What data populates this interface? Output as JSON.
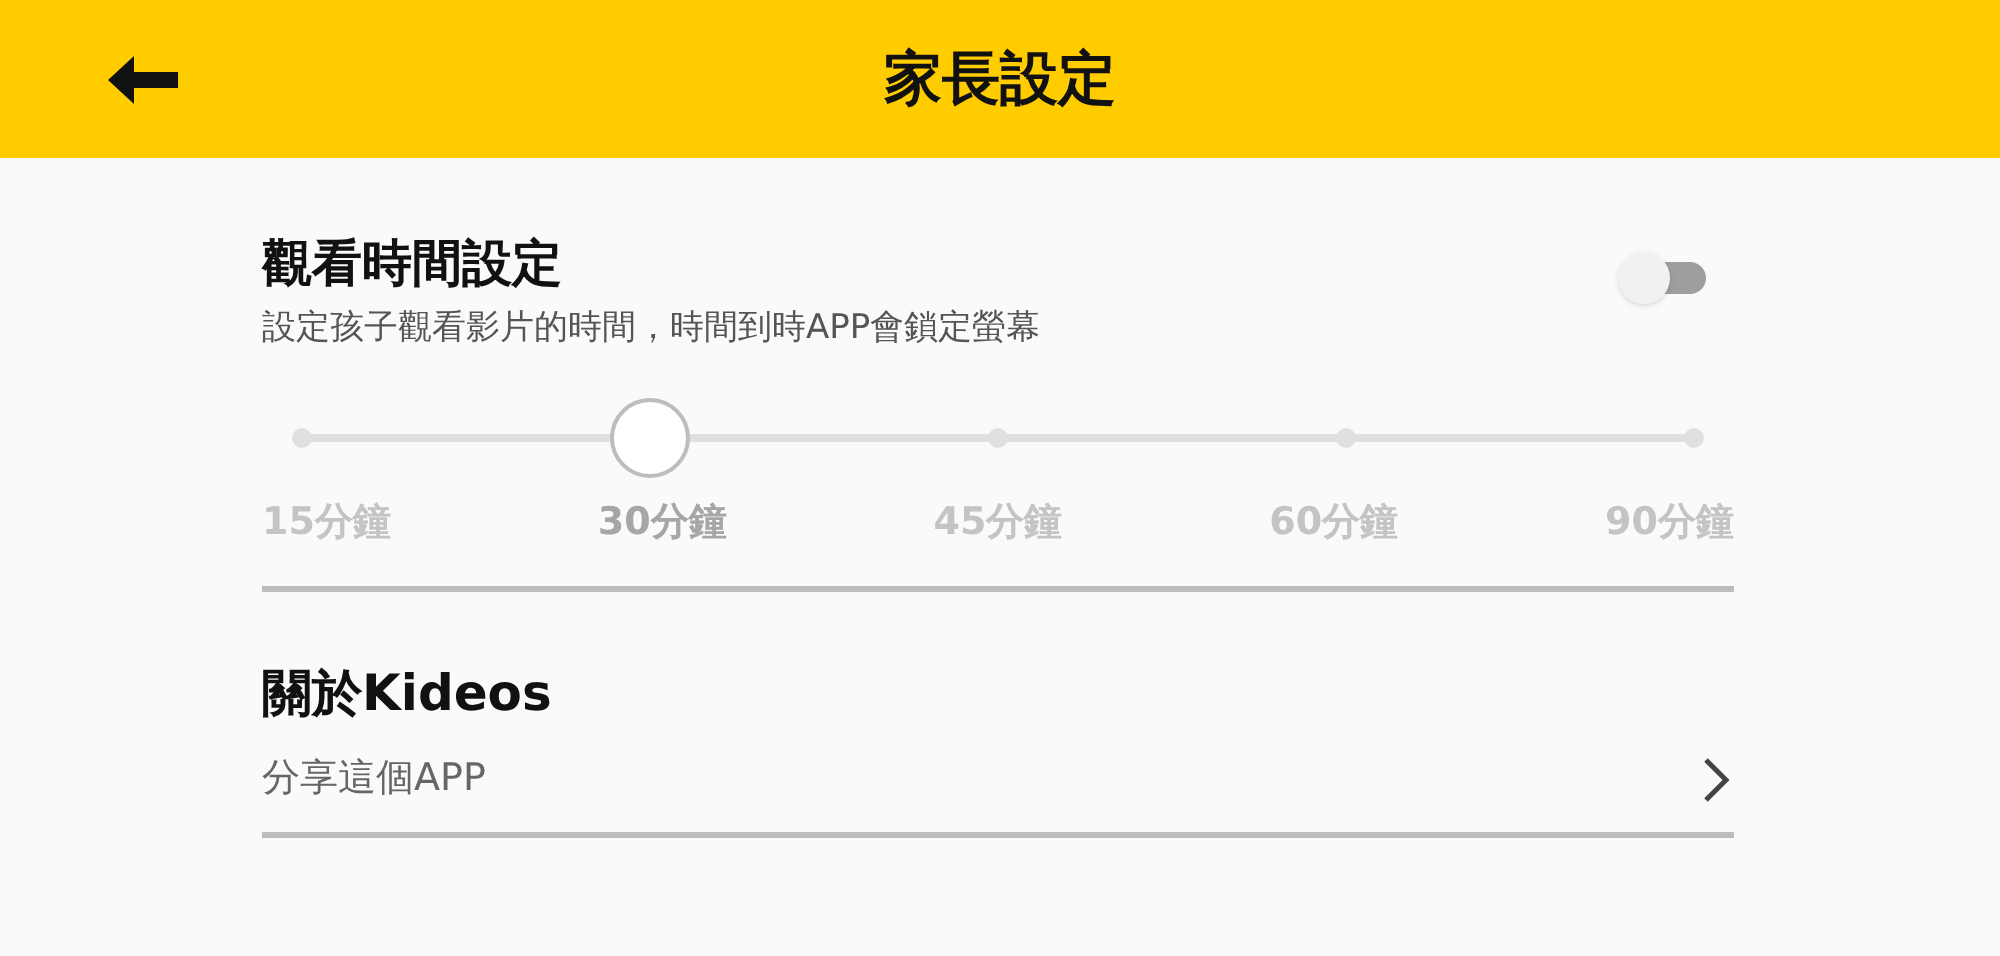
{
  "header": {
    "title": "家長設定"
  },
  "watch_time": {
    "title": "觀看時間設定",
    "description": "設定孩子觀看影片的時間，時間到時APP會鎖定螢幕",
    "toggle": {
      "on": false
    },
    "slider": {
      "level": 0.25,
      "stops": [
        {
          "label": "15分鐘",
          "selected": false
        },
        {
          "label": "30分鐘",
          "selected": true
        },
        {
          "label": "45分鐘",
          "selected": false
        },
        {
          "label": "60分鐘",
          "selected": false
        },
        {
          "label": "90分鐘",
          "selected": false
        }
      ]
    }
  },
  "about": {
    "title": "關於Kideos",
    "items": [
      {
        "label": "分享這個APP"
      }
    ]
  }
}
